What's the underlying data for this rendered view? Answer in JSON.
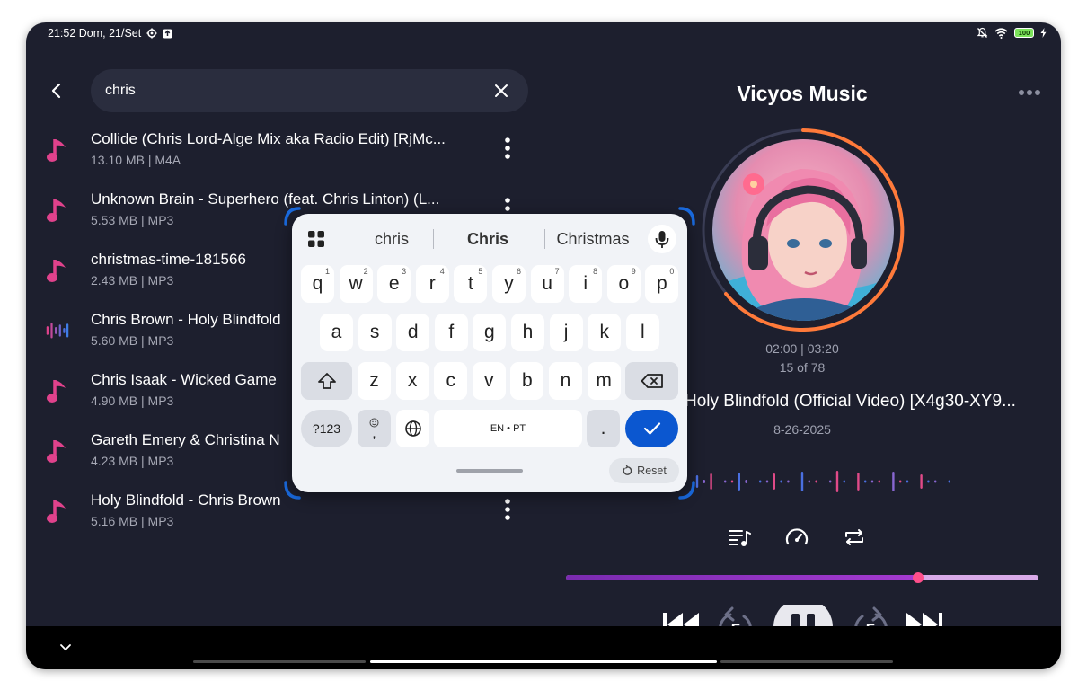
{
  "status_bar": {
    "time_date": "21:52 Dom, 21/Set",
    "battery": "100"
  },
  "search": {
    "value": "chris"
  },
  "results": [
    {
      "title": "Collide (Chris Lord-Alge Mix aka Radio Edit) [RjMc...",
      "meta": "13.10 MB  |  M4A",
      "icon": "music-note-icon"
    },
    {
      "title": "Unknown Brain - Superhero (feat. Chris Linton)  (L...",
      "meta": "5.53 MB  |  MP3",
      "icon": "music-note-icon"
    },
    {
      "title": "christmas-time-181566",
      "meta": "2.43 MB  |  MP3",
      "icon": "music-note-icon"
    },
    {
      "title": "Chris Brown - Holy Blindfold",
      "meta": "5.60 MB  |  MP3",
      "icon": "equalizer-playing-icon"
    },
    {
      "title": "Chris Isaak - Wicked Game",
      "meta": "4.90 MB  |  MP3",
      "icon": "music-note-icon"
    },
    {
      "title": "Gareth Emery & Christina N",
      "meta": "4.23 MB  |  MP3",
      "icon": "music-note-icon"
    },
    {
      "title": "Holy Blindfold - Chris Brown",
      "meta": "5.16 MB  |  MP3",
      "icon": "music-note-icon"
    }
  ],
  "player": {
    "app_title": "Vicyos Music",
    "time": "02:00 | 03:20",
    "position": "15 of 78",
    "track_title": "Holy Blindfold (Official Video) [X4g30-XY9...",
    "date": "8-26-2025",
    "progress_fraction": 0.745,
    "rewind_seconds": "5",
    "forward_seconds": "5"
  },
  "keyboard": {
    "suggestions": [
      "chris",
      "Chris",
      "Christmas"
    ],
    "row1": [
      {
        "k": "q",
        "n": "1"
      },
      {
        "k": "w",
        "n": "2"
      },
      {
        "k": "e",
        "n": "3"
      },
      {
        "k": "r",
        "n": "4"
      },
      {
        "k": "t",
        "n": "5"
      },
      {
        "k": "y",
        "n": "6"
      },
      {
        "k": "u",
        "n": "7"
      },
      {
        "k": "i",
        "n": "8"
      },
      {
        "k": "o",
        "n": "9"
      },
      {
        "k": "p",
        "n": "0"
      }
    ],
    "row2": [
      "a",
      "s",
      "d",
      "f",
      "g",
      "h",
      "j",
      "k",
      "l"
    ],
    "row3": [
      "z",
      "x",
      "c",
      "v",
      "b",
      "n",
      "m"
    ],
    "symbols_label": "?123",
    "emoji_comma_label": ",",
    "space_label": "EN • PT",
    "period_label": ".",
    "reset_label": "Reset"
  },
  "colors": {
    "background": "#1d1f2e",
    "accent_pink": "#e0428c",
    "progress_purple": "#8a2fc4",
    "keyboard_enter": "#0b57d0"
  }
}
